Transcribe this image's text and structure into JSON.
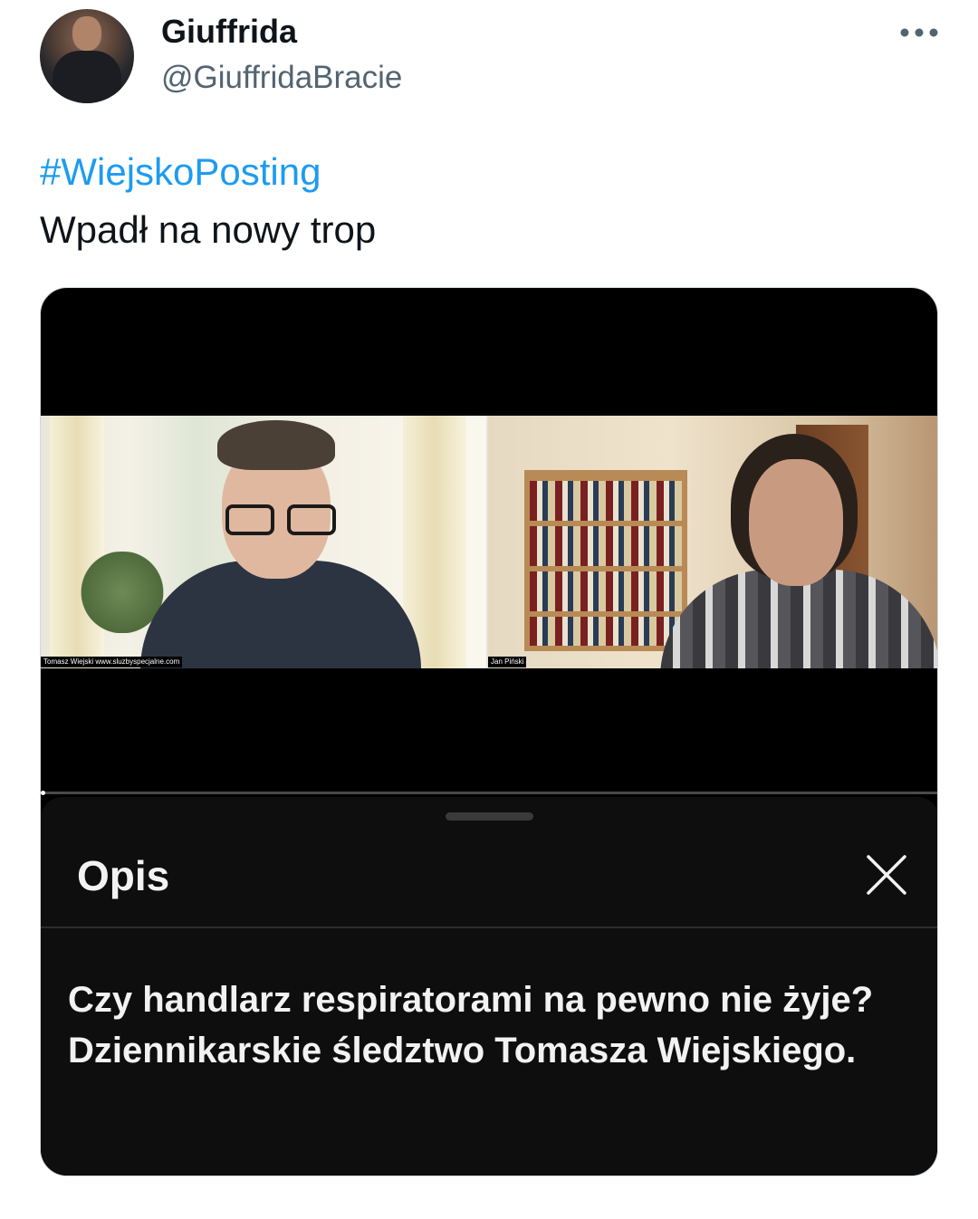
{
  "author": {
    "display_name": "Giuffrida",
    "handle": "@GiuffridaBracie",
    "avatar_alt": "profile photo"
  },
  "tweet": {
    "hashtag": "#WiejskoPosting",
    "text": "Wpadł na nowy trop"
  },
  "video": {
    "left_caption": "Tomasz Wiejski www.sluzbyspecjalne.com",
    "right_caption": "Jan Piński"
  },
  "description_sheet": {
    "title": "Opis",
    "body": "Czy handlarz respiratorami na pewno nie żyje? Dziennikarskie śledztwo Tomasza Wiejskiego."
  },
  "icons": {
    "more": "more-horizontal-icon",
    "close": "close-icon"
  },
  "colors": {
    "link": "#1d9bf0",
    "text": "#0f1419",
    "secondary": "#536471",
    "sheet_bg": "#0e0e0e"
  }
}
